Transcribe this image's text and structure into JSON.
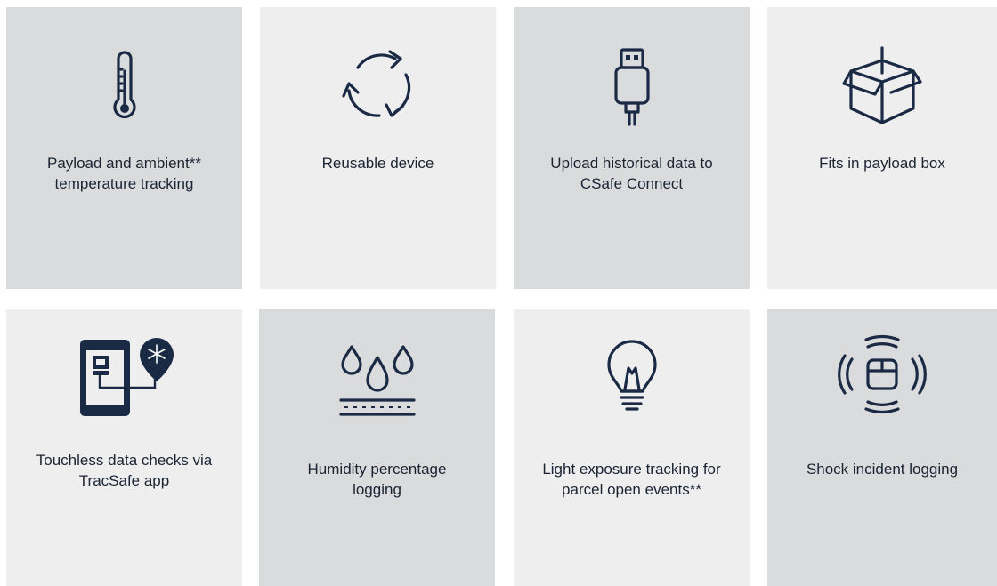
{
  "features": [
    {
      "icon": "thermometer-icon",
      "label": "Payload and ambient**\ntemperature tracking"
    },
    {
      "icon": "reuse-cycle-icon",
      "label": "Reusable device"
    },
    {
      "icon": "usb-icon",
      "label": "Upload historical data to\nCSafe Connect"
    },
    {
      "icon": "box-icon",
      "label": "Fits in payload box"
    },
    {
      "icon": "phone-app-icon",
      "label": "Touchless data checks via\nTracSafe app"
    },
    {
      "icon": "humidity-icon",
      "label": "Humidity percentage\nlogging"
    },
    {
      "icon": "lightbulb-icon",
      "label": "Light exposure tracking for\nparcel open events**"
    },
    {
      "icon": "shock-icon",
      "label": "Shock incident logging"
    }
  ],
  "colors": {
    "tile_dark": "#dadbdd",
    "tile_light": "#eeeeef",
    "icon_navy": "#1a2a45",
    "text": "#1b2433"
  }
}
